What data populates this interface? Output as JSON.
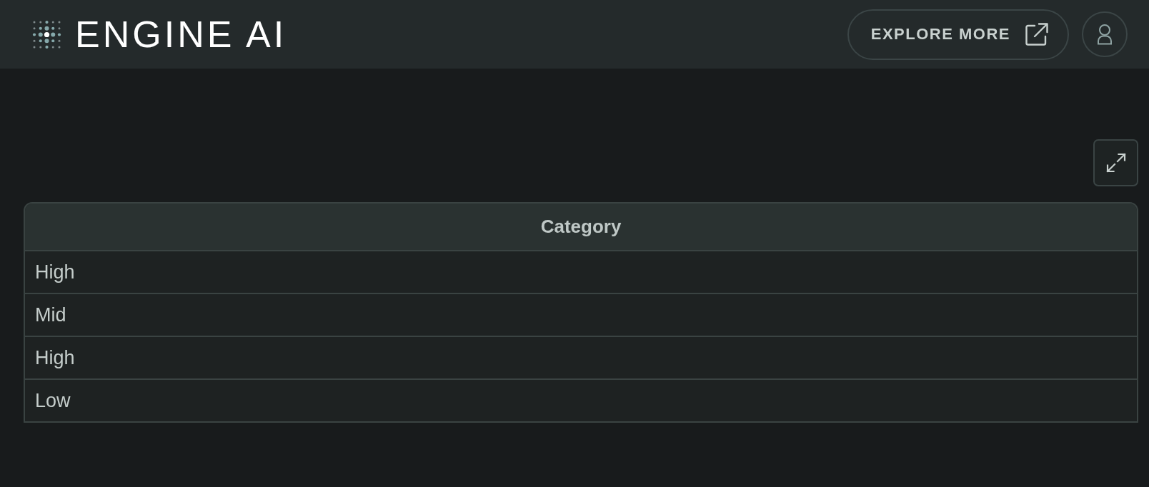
{
  "header": {
    "logo_text": "ENGINE AI",
    "explore_button": {
      "label": "EXPLORE MORE"
    }
  },
  "table": {
    "columns": [
      "Category"
    ],
    "rows": [
      [
        "High"
      ],
      [
        "Mid"
      ],
      [
        "High"
      ],
      [
        "Low"
      ]
    ]
  }
}
